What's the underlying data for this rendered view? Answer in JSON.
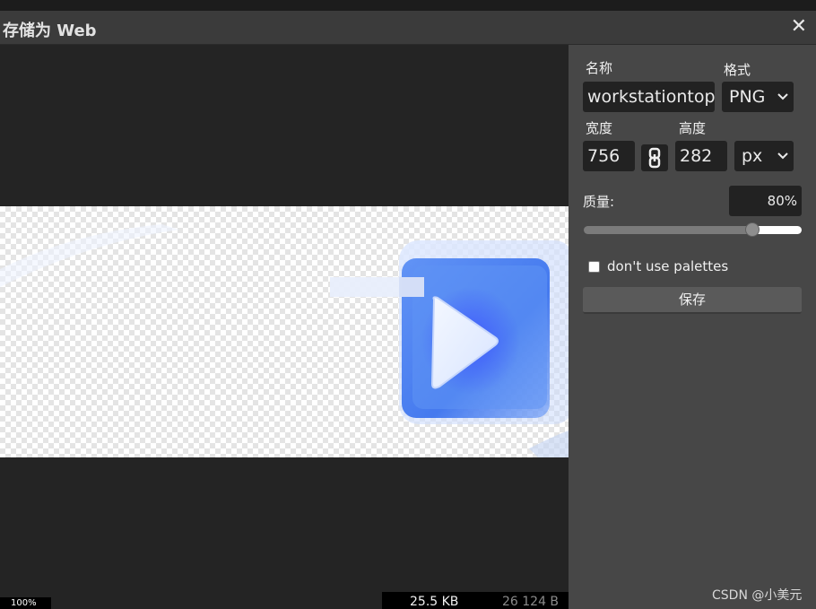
{
  "dialog": {
    "title": "存储为 Web",
    "close_glyph": "✕"
  },
  "preview": {
    "zoom_label": "100%",
    "file_size_kb": "25.5 KB",
    "file_size_bytes": "26 124 B"
  },
  "settings": {
    "name_label": "名称",
    "name_value": "workstationtop",
    "format_label": "格式",
    "format_value": "PNG",
    "width_label": "宽度",
    "width_value": "756",
    "height_label": "高度",
    "height_value": "282",
    "unit_value": "px",
    "quality_label": "质量:",
    "quality_value": "80%",
    "quality_level": 0.8,
    "palette_label": "don't use palettes",
    "palette_checked": false,
    "save_label": "保存"
  },
  "watermark": "CSDN @小美元",
  "icons": {
    "link": "chain-link-icon",
    "chevron": "chevron-down-icon",
    "close": "close-icon"
  }
}
